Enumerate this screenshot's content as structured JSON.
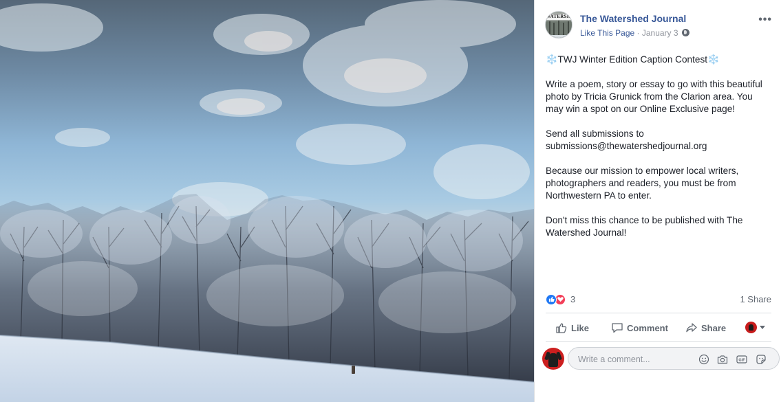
{
  "post": {
    "page_name": "The Watershed Journal",
    "avatar_text": "WATERSHED",
    "like_page": "Like This Page",
    "separator": "·",
    "date": "January 3",
    "more": "•••",
    "title_emoji": "❄️",
    "title": "TWJ Winter Edition Caption Contest",
    "paragraphs": [
      "Write a poem, story or essay to go with this beautiful photo by Tricia Grunick from the Clarion area. You may win a spot on our Online Exclusive page!",
      "Send all submissions to submissions@thewatershedjournal.org",
      "Because our mission to empower local writers, photographers and readers, you must be from Northwestern PA to enter.",
      "Don't miss this chance to be published with The Watershed Journal!"
    ]
  },
  "stats": {
    "reaction_count": "3",
    "share_count": "1 Share"
  },
  "actions": {
    "like": "Like",
    "comment": "Comment",
    "share": "Share"
  },
  "comment_input": {
    "placeholder": "Write a comment..."
  },
  "icons": {
    "globe": "globe-icon",
    "like_reaction": "like-reaction-icon",
    "love_reaction": "love-reaction-icon",
    "emoji": "emoji-icon",
    "camera": "camera-icon",
    "gif": "gif-icon",
    "sticker": "sticker-icon"
  },
  "colors": {
    "link": "#385898",
    "meta": "#90949c",
    "like_blue": "#2078f4",
    "love_red": "#f33e58"
  }
}
